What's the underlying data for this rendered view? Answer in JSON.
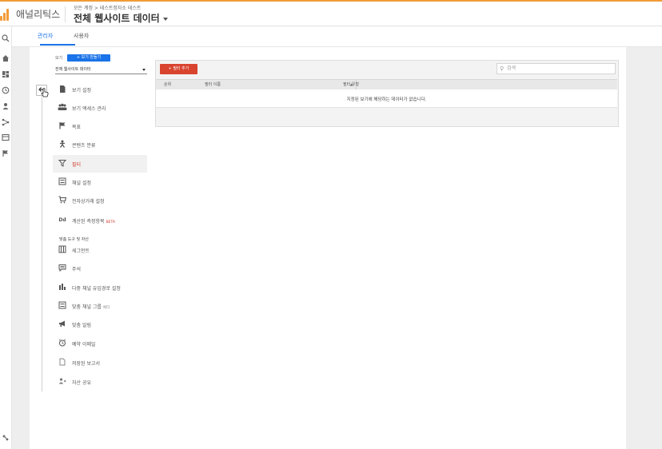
{
  "app": {
    "name": "애널리틱스",
    "breadcrumb": "모든 계정 > 테스트정자소 테스트",
    "view_title": "전체 웹사이트 데이터"
  },
  "rail_icons": [
    "search-icon",
    "home-icon",
    "dashboard-icon",
    "clock-icon",
    "person-icon",
    "branch-icon",
    "report-icon",
    "flag-icon",
    "settings-icon"
  ],
  "tabs": [
    {
      "label": "관리자",
      "active": true
    },
    {
      "label": "사용자",
      "active": false
    }
  ],
  "view_selector": {
    "label": "보기",
    "create_label": "+ 보기 만들기",
    "selected": "전체 웹사이트 데이터"
  },
  "nav": {
    "items": [
      {
        "label": "보기 설정",
        "icon": "document-icon"
      },
      {
        "label": "보기 액세스 관리",
        "icon": "people-icon"
      },
      {
        "label": "목표",
        "icon": "flag-icon"
      },
      {
        "label": "콘텐츠 분류",
        "icon": "person-icon"
      },
      {
        "label": "필터",
        "icon": "filter-icon",
        "active": true
      },
      {
        "label": "채널 설정",
        "icon": "channel-icon"
      },
      {
        "label": "전자상거래 설정",
        "icon": "cart-icon"
      },
      {
        "label": "계산된 측정항목",
        "icon": "dd-icon",
        "badge": "BETA"
      }
    ],
    "section_title": "맞춤 도구 및 자산",
    "section_items": [
      {
        "label": "세그먼트",
        "icon": "segment-icon"
      },
      {
        "label": "주석",
        "icon": "comment-icon"
      },
      {
        "label": "다중 채널 유입경로 설정",
        "icon": "bars-icon"
      },
      {
        "label": "맞춤 채널 그룹",
        "icon": "channel-icon",
        "badge": "베타"
      },
      {
        "label": "맞춤 알림",
        "icon": "megaphone-icon"
      },
      {
        "label": "예약 이메일",
        "icon": "alarm-icon"
      },
      {
        "label": "저장된 보고서",
        "icon": "saved-doc-icon"
      },
      {
        "label": "자산 공유",
        "icon": "share-icon"
      }
    ]
  },
  "filters": {
    "add_label": "+ 필터 추가",
    "search_placeholder": "검색",
    "columns": [
      "순위",
      "필터 이름",
      "필터 유형"
    ],
    "empty_message": "지정된 보기에 해당하는 데이터가 없습니다."
  },
  "colors": {
    "accent": "#f29b38",
    "primary": "#1a73e8",
    "danger": "#d9442f"
  }
}
